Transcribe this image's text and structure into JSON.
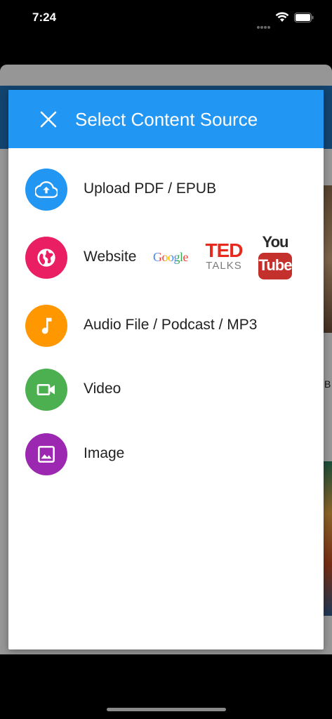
{
  "status_bar": {
    "time": "7:24"
  },
  "modal": {
    "title": "Select Content Source",
    "header_color": "#2196f3",
    "close_icon": "close-icon",
    "items": [
      {
        "label": "Upload PDF / EPUB",
        "icon": "cloud-upload-icon",
        "color": "#2196f3"
      },
      {
        "label": "Website",
        "icon": "globe-icon",
        "color": "#e91e63"
      },
      {
        "label": "Audio File / Podcast / MP3",
        "icon": "music-note-icon",
        "color": "#ff9800"
      },
      {
        "label": "Video",
        "icon": "video-camera-icon",
        "color": "#4caf50"
      },
      {
        "label": "Image",
        "icon": "image-icon",
        "color": "#9c27b0"
      }
    ],
    "website_logos": {
      "google": "Google",
      "ted": "TED",
      "ted_sub": "TALKS",
      "youtube_you": "You",
      "youtube_tube": "Tube"
    }
  },
  "background": {
    "partial_letter": "B"
  }
}
